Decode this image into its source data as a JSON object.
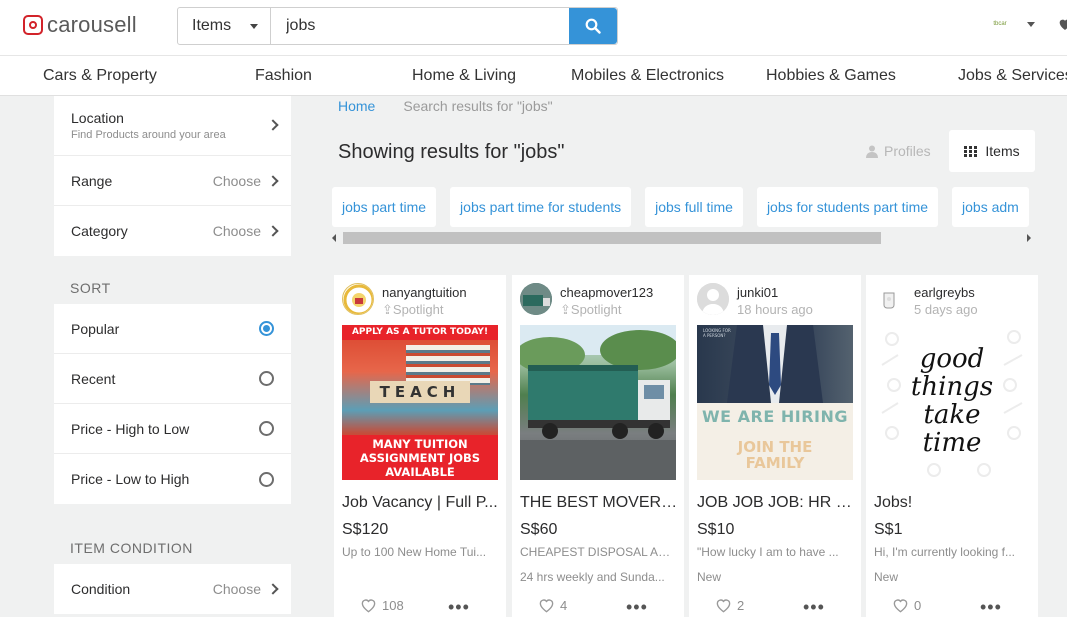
{
  "header": {
    "logo_text": "carousell",
    "search_category": "Items",
    "search_query": "jobs",
    "avatar_text": "tbcar"
  },
  "nav": {
    "categories": [
      "Cars & Property",
      "Fashion",
      "Home & Living",
      "Mobiles & Electronics",
      "Hobbies & Games",
      "Jobs & Services"
    ]
  },
  "sidebar": {
    "location_label": "Location",
    "location_sub": "Find Products around your area",
    "range_label": "Range",
    "range_value": "Choose",
    "category_label": "Category",
    "category_value": "Choose",
    "sort_title": "SORT",
    "sort_options": [
      "Popular",
      "Recent",
      "Price - High to Low",
      "Price - Low to High"
    ],
    "sort_selected": "Popular",
    "condition_title": "ITEM CONDITION",
    "condition_label": "Condition",
    "condition_value": "Choose"
  },
  "main": {
    "breadcrumb_home": "Home",
    "breadcrumb_current": "Search results for \"jobs\"",
    "heading": "Showing results for \"jobs\"",
    "profiles_label": "Profiles",
    "items_label": "Items",
    "chips": [
      "jobs part time",
      "jobs part time for students",
      "jobs full time",
      "jobs for students part time",
      "jobs adm"
    ]
  },
  "listings": [
    {
      "user": "nanyangtuition",
      "meta": "Spotlight",
      "image_top": "APPLY AS A TUTOR TODAY!",
      "image_word": "TEACH",
      "image_bottom": "MANY TUITION ASSIGNMENT JOBS AVAILABLE",
      "title": "Job Vacancy | Full P...",
      "price": "S$120",
      "desc": "Up to 100 New Home Tui...",
      "line2": "",
      "likes": "108"
    },
    {
      "user": "cheapmover123",
      "meta": "Spotlight",
      "title": "THE BEST MOVERS ...",
      "price": "S$60",
      "desc": "CHEAPEST DISPOSAL AN...",
      "line2": "24 hrs weekly and Sunda...",
      "likes": "4"
    },
    {
      "user": "junki01",
      "meta": "18 hours ago",
      "image_tag": "LOOKING FOR A PERSON?",
      "image_top": "WE ARE HIRING",
      "image_bottom": "JOIN THE FAMILY",
      "title": "JOB JOB JOB: HR R...",
      "price": "S$10",
      "desc": "\"How lucky I am to have ...",
      "line2": "New",
      "likes": "2"
    },
    {
      "user": "earlgreybs",
      "meta": "5 days ago",
      "image_script": "good things take time",
      "title": "Jobs!",
      "price": "S$1",
      "desc": "Hi, I'm currently looking f...",
      "line2": "New",
      "likes": "0"
    }
  ],
  "colors": {
    "accent": "#3593d8",
    "brand": "#d2232a"
  }
}
